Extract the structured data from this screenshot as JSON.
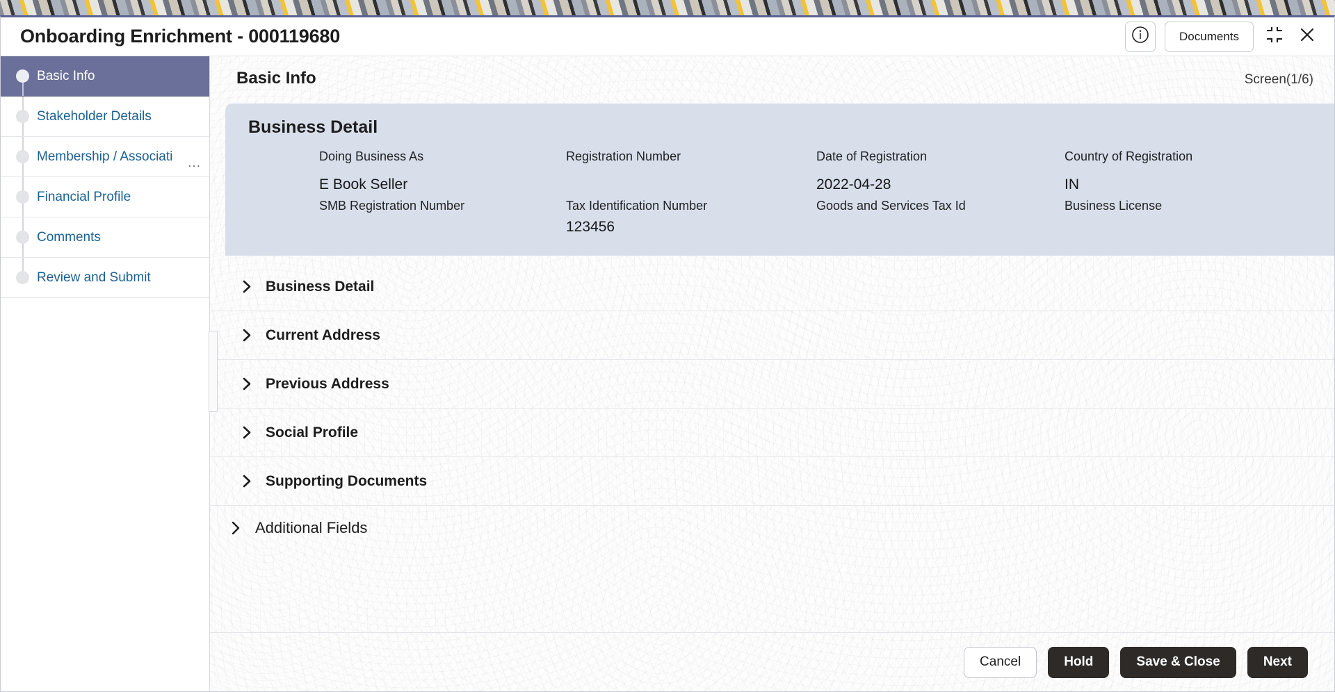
{
  "window": {
    "title": "Onboarding Enrichment - 000119680",
    "info_icon": "info-circle-icon",
    "documents_label": "Documents",
    "minimize_icon": "collapse-corners-icon",
    "close_icon": "close-x-icon"
  },
  "sidebar": {
    "items": [
      {
        "label": "Basic Info",
        "active": true
      },
      {
        "label": "Stakeholder Details",
        "active": false
      },
      {
        "label": "Membership / Associati",
        "active": false,
        "truncated": true,
        "ellipsis": "..."
      },
      {
        "label": "Financial Profile",
        "active": false
      },
      {
        "label": "Comments",
        "active": false
      },
      {
        "label": "Review and Submit",
        "active": false
      }
    ]
  },
  "content": {
    "section_title": "Basic Info",
    "screen_indicator": "Screen(1/6)",
    "summary": {
      "title": "Business Detail",
      "columns": [
        {
          "label_1": "Doing Business As",
          "value_1": "E Book Seller",
          "label_2": "SMB Registration Number",
          "value_2": ""
        },
        {
          "label_1": "Registration Number",
          "value_1": "",
          "label_2": "Tax Identification Number",
          "value_2": "123456"
        },
        {
          "label_1": "Date of Registration",
          "value_1": "2022-04-28",
          "label_2": "Goods and Services Tax Id",
          "value_2": ""
        },
        {
          "label_1": "Country of Registration",
          "value_1": "IN",
          "label_2": "Business License",
          "value_2": ""
        }
      ]
    },
    "accordions_inner": [
      {
        "label": "Business Detail",
        "expanded": false
      },
      {
        "label": "Current Address",
        "expanded": false
      },
      {
        "label": "Previous Address",
        "expanded": false
      },
      {
        "label": "Social Profile",
        "expanded": false
      },
      {
        "label": "Supporting Documents",
        "expanded": false
      }
    ],
    "accordion_outer": {
      "label": "Additional Fields",
      "expanded": false
    }
  },
  "footer": {
    "cancel_label": "Cancel",
    "hold_label": "Hold",
    "save_close_label": "Save & Close",
    "next_label": "Next"
  },
  "colors": {
    "active_step_bg": "#6a7099",
    "summary_panel_bg": "#d8dfea",
    "link_text": "#1b6093",
    "dark_button_bg": "#2d2a28",
    "title_accent": "#5b6192"
  }
}
